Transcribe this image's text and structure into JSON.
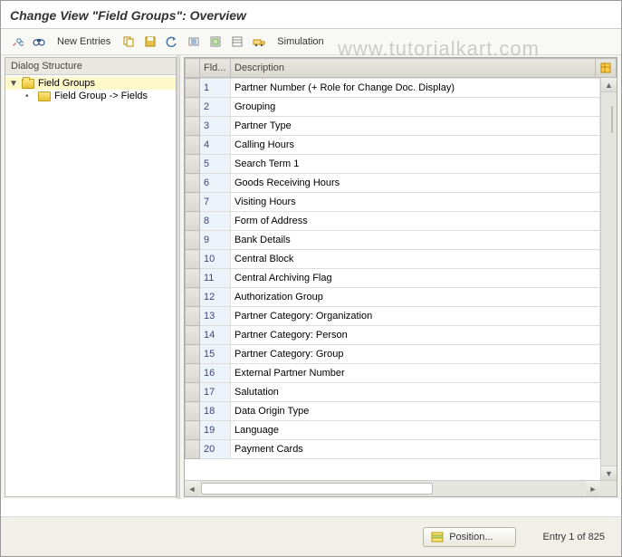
{
  "title": "Change View \"Field Groups\": Overview",
  "watermark": "www.tutorialkart.com",
  "toolbar": {
    "new_entries": "New Entries",
    "simulation": "Simulation"
  },
  "tree": {
    "header": "Dialog Structure",
    "root": "Field Groups",
    "child": "Field Group -> Fields"
  },
  "table": {
    "col_fld": "Fld...",
    "col_desc": "Description",
    "rows": [
      {
        "n": "1",
        "d": "Partner Number (+ Role for Change Doc. Display)"
      },
      {
        "n": "2",
        "d": "Grouping"
      },
      {
        "n": "3",
        "d": "Partner Type"
      },
      {
        "n": "4",
        "d": "Calling Hours"
      },
      {
        "n": "5",
        "d": "Search Term 1"
      },
      {
        "n": "6",
        "d": "Goods Receiving Hours"
      },
      {
        "n": "7",
        "d": "Visiting Hours"
      },
      {
        "n": "8",
        "d": "Form of Address"
      },
      {
        "n": "9",
        "d": "Bank Details"
      },
      {
        "n": "10",
        "d": "Central Block"
      },
      {
        "n": "11",
        "d": "Central Archiving Flag"
      },
      {
        "n": "12",
        "d": "Authorization Group"
      },
      {
        "n": "13",
        "d": "Partner Category: Organization"
      },
      {
        "n": "14",
        "d": "Partner Category: Person"
      },
      {
        "n": "15",
        "d": "Partner Category: Group"
      },
      {
        "n": "16",
        "d": "External Partner Number"
      },
      {
        "n": "17",
        "d": "Salutation"
      },
      {
        "n": "18",
        "d": "Data Origin Type"
      },
      {
        "n": "19",
        "d": "Language"
      },
      {
        "n": "20",
        "d": "Payment Cards"
      }
    ]
  },
  "footer": {
    "position": "Position...",
    "entry": "Entry 1 of 825"
  }
}
